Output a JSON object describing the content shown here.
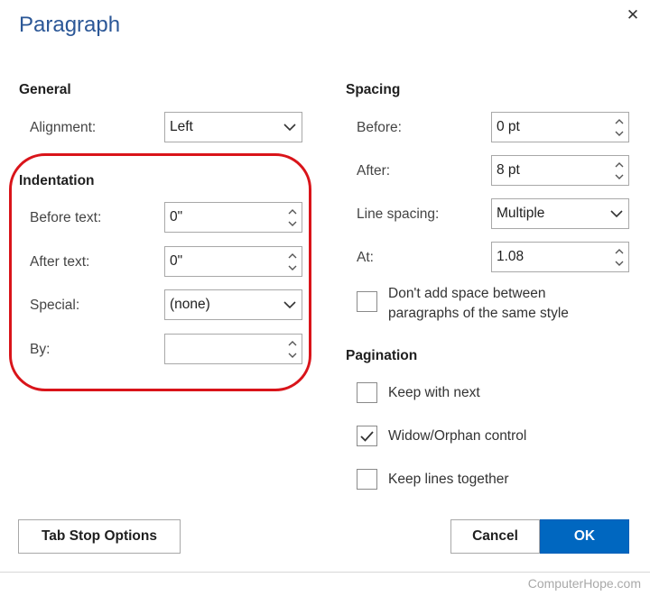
{
  "dialog": {
    "title": "Paragraph",
    "close_icon": "close-icon"
  },
  "general": {
    "heading": "General",
    "alignment_label": "Alignment:",
    "alignment_value": "Left"
  },
  "indentation": {
    "heading": "Indentation",
    "before_label": "Before text:",
    "before_value": "0\"",
    "after_label": "After text:",
    "after_value": "0\"",
    "special_label": "Special:",
    "special_value": "(none)",
    "by_label": "By:",
    "by_value": "",
    "highlight_color": "#d9141a"
  },
  "spacing": {
    "heading": "Spacing",
    "before_label": "Before:",
    "before_value": "0 pt",
    "after_label": "After:",
    "after_value": "8 pt",
    "line_spacing_label": "Line spacing:",
    "line_spacing_value": "Multiple",
    "at_label": "At:",
    "at_value": "1.08",
    "dont_add_line1": "Don't add space between",
    "dont_add_line2": "paragraphs of the same style",
    "dont_add_checked": false
  },
  "pagination": {
    "heading": "Pagination",
    "items": [
      {
        "label": "Keep with next",
        "checked": false
      },
      {
        "label": "Widow/Orphan control",
        "checked": true
      },
      {
        "label": "Keep lines together",
        "checked": false
      }
    ]
  },
  "buttons": {
    "tab_stop": "Tab Stop Options",
    "cancel": "Cancel",
    "ok": "OK"
  },
  "footer": {
    "watermark": "ComputerHope.com"
  },
  "colors": {
    "title": "#2b5797",
    "ok_button": "#0067c0"
  }
}
